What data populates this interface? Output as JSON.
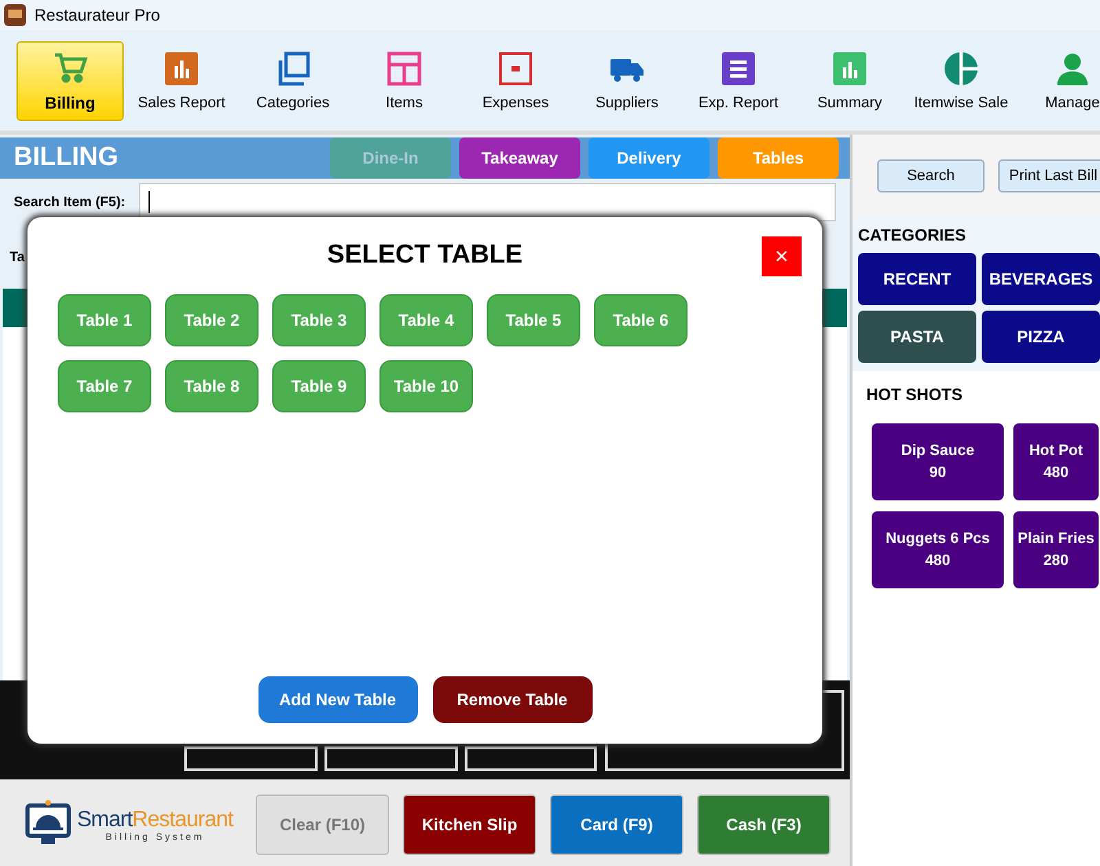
{
  "window": {
    "title": "Restaurateur Pro"
  },
  "toolbar": [
    {
      "label": "Billing",
      "selected": true
    },
    {
      "label": "Sales Report",
      "selected": false
    },
    {
      "label": "Categories",
      "selected": false
    },
    {
      "label": "Items",
      "selected": false
    },
    {
      "label": "Expenses",
      "selected": false
    },
    {
      "label": "Suppliers",
      "selected": false
    },
    {
      "label": "Exp. Report",
      "selected": false
    },
    {
      "label": "Summary",
      "selected": false
    },
    {
      "label": "Itemwise Sale",
      "selected": false
    },
    {
      "label": "Manage",
      "selected": false
    }
  ],
  "billing": {
    "title": "BILLING",
    "tabs": [
      {
        "label": "Dine-In",
        "selected": true,
        "color": "#4fa39b"
      },
      {
        "label": "Takeaway",
        "selected": false,
        "color": "#9c27b0"
      },
      {
        "label": "Delivery",
        "selected": false,
        "color": "#2196f3"
      },
      {
        "label": "Tables",
        "selected": false,
        "color": "#ff9800"
      }
    ],
    "search_label": "Search Item (F5):",
    "second_label": "Ta"
  },
  "side": {
    "buttons": [
      "Search",
      "Print Last Bill"
    ],
    "categories_title": "CATEGORIES",
    "categories": [
      {
        "label": "RECENT",
        "selected": false
      },
      {
        "label": "BEVERAGES",
        "selected": false
      },
      {
        "label": "PASTA",
        "selected": true
      },
      {
        "label": "PIZZA",
        "selected": false
      }
    ],
    "hot_title": "HOT SHOTS",
    "hot_items": [
      {
        "name": "Dip Sauce",
        "price": "90"
      },
      {
        "name": "Hot Pot",
        "price": "480"
      },
      {
        "name": "Nuggets 6 Pcs",
        "price": "480"
      },
      {
        "name": "Plain Fries",
        "price": "280"
      }
    ]
  },
  "logo": {
    "brand_a": "Smart",
    "brand_b": "Restaurant",
    "tagline": "Billing System"
  },
  "actions": [
    {
      "label": "Clear (F10)",
      "disabled": true,
      "color": "#e0e0e0"
    },
    {
      "label": "Kitchen Slip",
      "disabled": false,
      "color": "#8b0000"
    },
    {
      "label": "Card (F9)",
      "disabled": false,
      "color": "#0b6fbf"
    },
    {
      "label": "Cash (F3)",
      "disabled": false,
      "color": "#2e7d32"
    }
  ],
  "modal": {
    "title": "SELECT TABLE",
    "close": "×",
    "tables": [
      "Table 1",
      "Table 2",
      "Table 3",
      "Table 4",
      "Table 5",
      "Table 6",
      "Table 7",
      "Table 8",
      "Table 9",
      "Table 10"
    ],
    "buttons": [
      {
        "label": "Add New Table",
        "kind": "add"
      },
      {
        "label": "Remove Table",
        "kind": "remove"
      }
    ]
  }
}
